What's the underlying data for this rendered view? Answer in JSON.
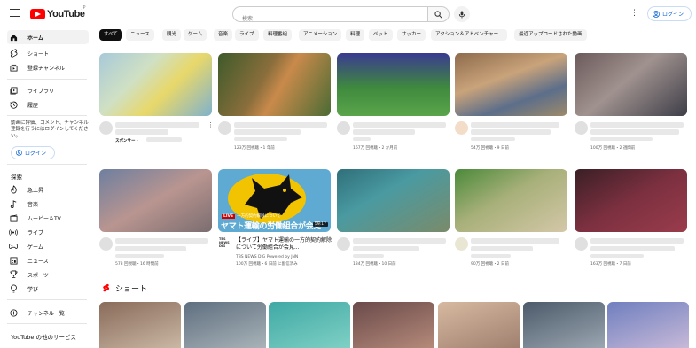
{
  "header": {
    "logo_text": "YouTube",
    "country_code": "JP",
    "search_placeholder": "検索",
    "login_label": "ログイン"
  },
  "sidebar": {
    "main_items": [
      {
        "label": "ホーム",
        "icon": "home-icon",
        "active": true
      },
      {
        "label": "ショート",
        "icon": "shorts-icon"
      },
      {
        "label": "登録チャンネル",
        "icon": "subscriptions-icon"
      }
    ],
    "library_items": [
      {
        "label": "ライブラリ",
        "icon": "library-icon"
      },
      {
        "label": "履歴",
        "icon": "history-icon"
      }
    ],
    "signin_prompt": "動画に評価、コメント、チャンネル登録を行うにはログインしてください。",
    "login_label": "ログイン",
    "explore_title": "探索",
    "explore_items": [
      {
        "label": "急上昇",
        "icon": "trending-icon"
      },
      {
        "label": "音楽",
        "icon": "music-icon"
      },
      {
        "label": "ムービー＆TV",
        "icon": "movies-icon"
      },
      {
        "label": "ライブ",
        "icon": "live-icon"
      },
      {
        "label": "ゲーム",
        "icon": "gaming-icon"
      },
      {
        "label": "ニュース",
        "icon": "news-icon"
      },
      {
        "label": "スポーツ",
        "icon": "sports-icon"
      },
      {
        "label": "学び",
        "icon": "learning-icon"
      }
    ],
    "channel_list_item": {
      "label": "チャンネル一覧",
      "icon": "add-circle-icon"
    },
    "other_services_title": "YouTube の他のサービス"
  },
  "chips": [
    "すべて",
    "ニュース",
    "観光",
    "ゲーム",
    "音楽",
    "ライブ",
    "料理番組",
    "アニメーション",
    "料理",
    "ペット",
    "サッカー",
    "アクション＆アドベンチャー...",
    "最近アップロードされた動画"
  ],
  "videos_row1": [
    {
      "meta": "",
      "sponsor": "スポンサー・"
    },
    {
      "meta": "123万 回視聴・1 年前"
    },
    {
      "meta": "167万 回視聴・2 か月前"
    },
    {
      "meta": "54万 回視聴・9 日前"
    },
    {
      "meta": "100万 回視聴・2 週間前"
    }
  ],
  "videos_row2": [
    {
      "meta": "573 回視聴・16 時間前"
    },
    {
      "meta": ""
    },
    {
      "meta": "134万 回視聴・10 日前"
    },
    {
      "meta": "90万 回視聴・2 日前"
    },
    {
      "meta": "163万 回視聴・7 日前"
    }
  ],
  "featured_video": {
    "live_badge": "LIVE",
    "live_caption": "一方的契約解除について",
    "overlay_title": "ヤマト運輸の労働組合が会見",
    "duration": "59:17",
    "title": "【ライブ】ヤマト運輸の一方的契約解除について労働組合が会見...",
    "channel": "TBS NEWS DIG Powered by JNN",
    "meta": "100万 回視聴・6 日前 に配信済み",
    "channel_logo": "TBS NEWS DIG"
  },
  "shorts": {
    "title": "ショート"
  },
  "colors": {
    "accent": "#065fd4",
    "brand_red": "#ff0000",
    "chip_active": "#0f0f0f",
    "chip_bg": "#f2f2f2"
  }
}
